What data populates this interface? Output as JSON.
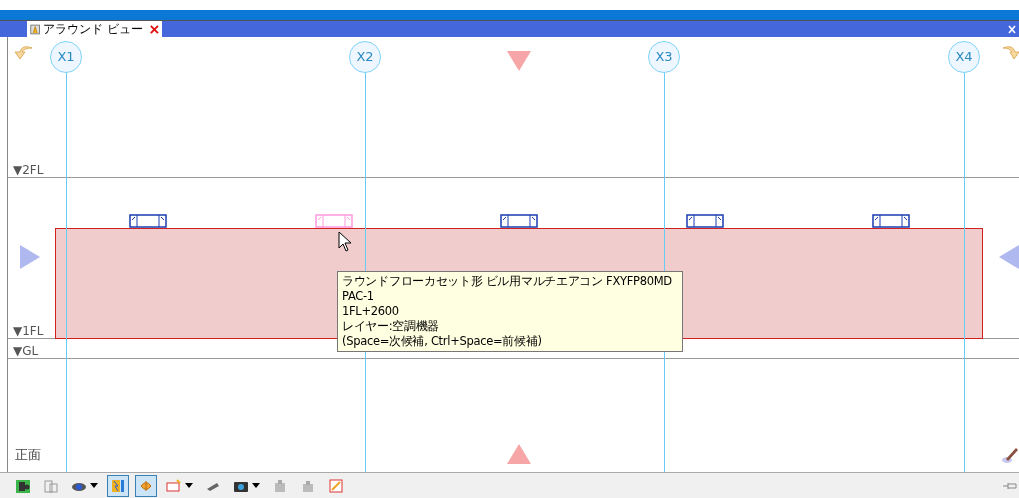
{
  "tab": {
    "title": "アラウンド ビュー",
    "selected": true
  },
  "grid_axes": [
    {
      "label": "X1"
    },
    {
      "label": "X2"
    },
    {
      "label": "X3"
    },
    {
      "label": "X4"
    }
  ],
  "levels": [
    {
      "label": "▼2FL"
    },
    {
      "label": "▼1FL"
    },
    {
      "label": "▼GL"
    }
  ],
  "units": [
    {
      "highlighted": false
    },
    {
      "highlighted": true
    },
    {
      "highlighted": false
    },
    {
      "highlighted": false
    },
    {
      "highlighted": false
    }
  ],
  "tooltip": {
    "lines": [
      "ラウンドフローカセット形 ビル用マルチエアコン FXYFP80MD",
      "PAC-1",
      "1FL+2600",
      "レイヤー:空調機器",
      "(Space=次候補, Ctrl+Space=前候補)"
    ]
  },
  "view_label": "正面",
  "toolbar": [
    {
      "kind": "plain",
      "selected": false
    },
    {
      "kind": "plain",
      "selected": false
    },
    {
      "kind": "dropdown",
      "selected": false
    },
    {
      "kind": "plain",
      "selected": true
    },
    {
      "kind": "plain",
      "selected": true
    },
    {
      "kind": "dropdown",
      "selected": false
    },
    {
      "kind": "plain",
      "selected": false
    },
    {
      "kind": "dropdown",
      "selected": false
    },
    {
      "kind": "plain",
      "selected": false
    },
    {
      "kind": "plain",
      "selected": false
    },
    {
      "kind": "plain",
      "selected": false
    }
  ]
}
